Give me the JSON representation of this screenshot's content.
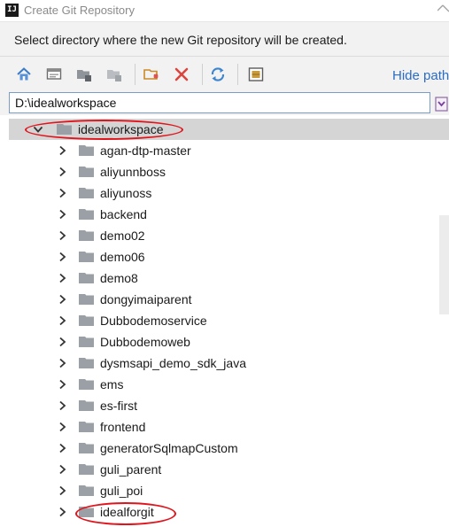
{
  "window": {
    "title": "Create Git Repository",
    "app_icon_text": "IJ"
  },
  "description": "Select directory where the new Git repository will be created.",
  "toolbar": {
    "buttons": [
      "home-icon",
      "desktop-icon",
      "module-folder-icon",
      "project-folder-icon",
      "new-folder-icon",
      "delete-icon",
      "refresh-icon",
      "show-hidden-icon"
    ],
    "hide_path_label": "Hide path"
  },
  "path": {
    "value": "D:\\idealworkspace"
  },
  "tree": {
    "root": {
      "label": "idealworkspace",
      "expanded": true
    },
    "items": [
      {
        "label": "agan-dtp-master"
      },
      {
        "label": "aliyunnboss"
      },
      {
        "label": "aliyunoss"
      },
      {
        "label": "backend"
      },
      {
        "label": "demo02"
      },
      {
        "label": "demo06"
      },
      {
        "label": "demo8"
      },
      {
        "label": "dongyimaiparent"
      },
      {
        "label": "Dubbodemoservice"
      },
      {
        "label": "Dubbodemoweb"
      },
      {
        "label": "dysmsapi_demo_sdk_java"
      },
      {
        "label": "ems"
      },
      {
        "label": "es-first"
      },
      {
        "label": "frontend"
      },
      {
        "label": "generatorSqlmapCustom"
      },
      {
        "label": "guli_parent"
      },
      {
        "label": "guli_poi"
      },
      {
        "label": "idealforgit"
      }
    ]
  },
  "colors": {
    "annotation": "#e0141c",
    "link": "#2b6cc4",
    "folder": "#9aa0a6",
    "selection": "#d5d5d5"
  }
}
